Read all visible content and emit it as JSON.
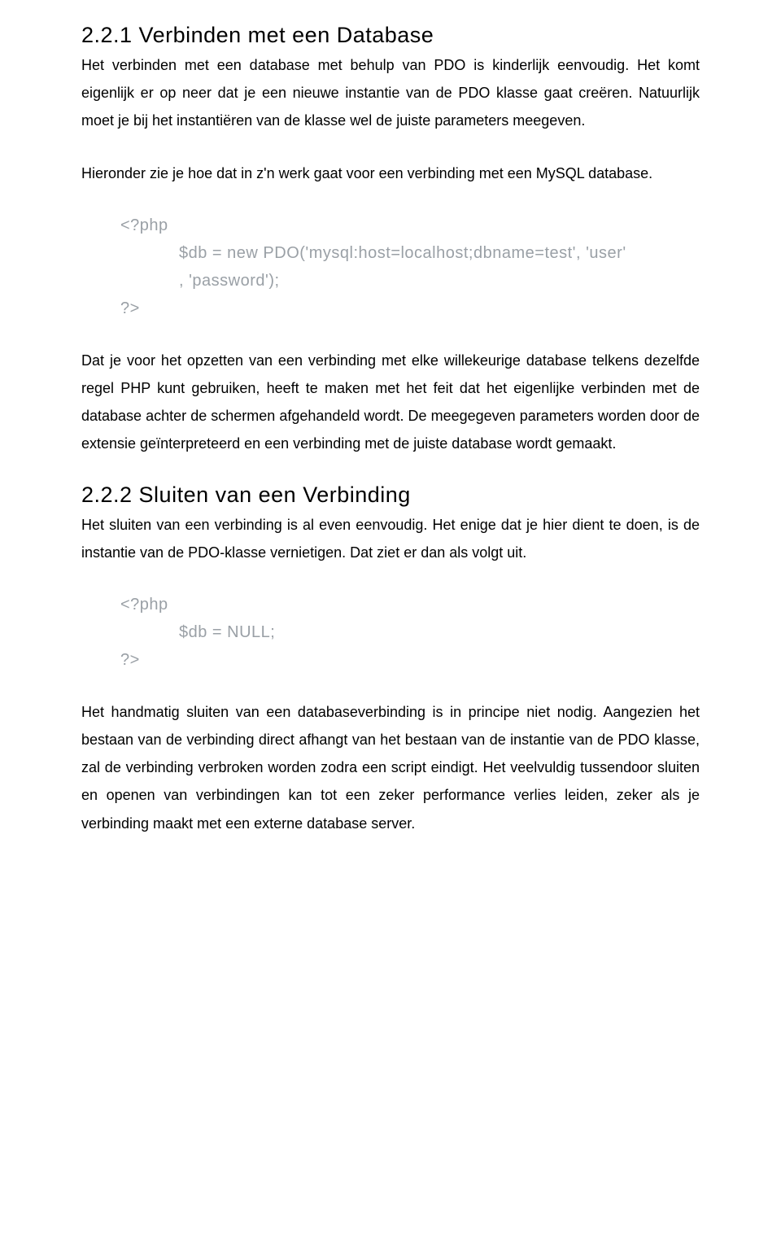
{
  "section1": {
    "heading": "2.2.1 Verbinden met een Database",
    "p1": "Het verbinden met een database met behulp van PDO is kinderlijk eenvoudig. Het komt eigenlijk er op neer dat je een nieuwe instantie van de PDO klasse gaat creëren. Natuurlijk moet je bij het instantiëren van de klasse wel de juiste parameters meegeven.",
    "p2": "Hieronder zie je hoe dat in z'n werk gaat voor een verbinding met een MySQL database.",
    "code": {
      "open": "<?php",
      "line1": "$db = new PDO('mysql:host=localhost;dbname=test', 'user'",
      "line2": ", 'password');",
      "close": "?>"
    },
    "p3": "Dat je voor het opzetten van een verbinding met elke willekeurige database telkens dezelfde regel PHP kunt gebruiken, heeft te maken met het feit dat het eigenlijke verbinden met de database achter de schermen afgehandeld wordt. De meegegeven parameters worden door de extensie geïnterpreteerd en een verbinding met de juiste database wordt gemaakt."
  },
  "section2": {
    "heading": "2.2.2 Sluiten van een Verbinding",
    "p1": "Het sluiten van een verbinding is al even eenvoudig. Het enige dat je hier dient te doen, is de instantie van de PDO-klasse vernietigen. Dat ziet er dan als volgt uit.",
    "code": {
      "open": "<?php",
      "line1": "$db = NULL;",
      "close": "?>"
    },
    "p2": "Het handmatig sluiten van een databaseverbinding is in principe niet nodig. Aangezien het bestaan van de verbinding direct afhangt van het bestaan van de instantie van de PDO klasse, zal de verbinding verbroken worden zodra een script eindigt. Het veelvuldig tussendoor sluiten en openen van verbindingen kan tot een zeker performance verlies leiden, zeker als je verbinding maakt met een externe database server."
  }
}
